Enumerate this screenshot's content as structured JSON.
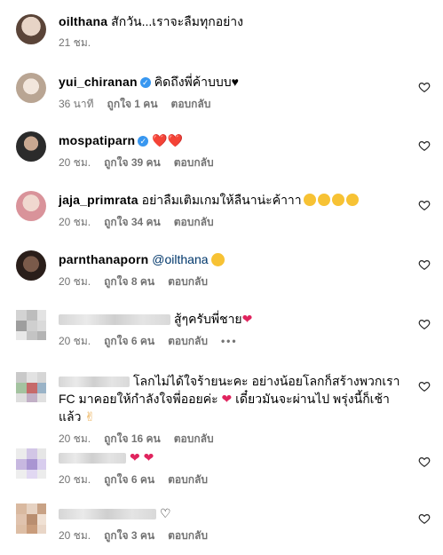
{
  "top": {
    "username": "oilthana",
    "text": "สักวัน...เราจะลืมทุกอย่าง",
    "time": "21 ชม."
  },
  "labels": {
    "like_count_prefix": "ถูกใจ",
    "like_count_suffix": "คน",
    "reply": "ตอบกลับ",
    "more": "•••"
  },
  "comments": [
    {
      "username": "yui_chiranan",
      "verified": true,
      "text": "คิดถึงพี่ค้าบบบ♥",
      "time": "36 นาที",
      "likes": "ถูกใจ 1 คน",
      "reply": "ตอบกลับ"
    },
    {
      "username": "mospatiparn",
      "verified": true,
      "text": "❤️❤️",
      "time": "20 ชม.",
      "likes": "ถูกใจ 39 คน",
      "reply": "ตอบกลับ"
    },
    {
      "username": "jaja_primrata",
      "verified": false,
      "text": "อย่าลืมเติมเกมให้ลืนาน่ะค้าาา",
      "time": "20 ชม.",
      "likes": "ถูกใจ 34 คน",
      "reply": "ตอบกลับ"
    },
    {
      "username": "parnthanaporn",
      "verified": false,
      "text": "@oilthana",
      "time": "20 ชม.",
      "likes": "ถูกใจ 8 คน",
      "reply": "ตอบกลับ"
    },
    {
      "username": "",
      "verified": false,
      "text": "สู้ๆครับพี่ชาย",
      "time": "20 ชม.",
      "likes": "ถูกใจ 6 คน",
      "reply": "ตอบกลับ"
    },
    {
      "username": "",
      "verified": false,
      "text": "โลกไม่ได้ใจร้ายนะคะ อย่างน้อยโลกก็สร้างพวกเรา FC มาคอยให้กำลังใจพี่ออยค่ะ",
      "text2": "เดี๋ยวมันจะผ่านไป พรุ่งนี้ก็เช้าแล้ว",
      "time": "20 ชม.",
      "likes": "ถูกใจ 16 คน",
      "reply": "ตอบกลับ"
    },
    {
      "username": "",
      "verified": false,
      "text": "",
      "time": "20 ชม.",
      "likes": "ถูกใจ 6 คน",
      "reply": "ตอบกลับ"
    },
    {
      "username": "",
      "verified": false,
      "text": "",
      "time": "20 ชม.",
      "likes": "ถูกใจ 3 คน",
      "reply": "ตอบกลับ"
    }
  ],
  "colors": {
    "meta": "#737373",
    "heart": "#e0245e",
    "verified": "#3897f0"
  },
  "icons": {
    "like": "heart-outline-icon",
    "verified": "verified-badge-icon"
  }
}
